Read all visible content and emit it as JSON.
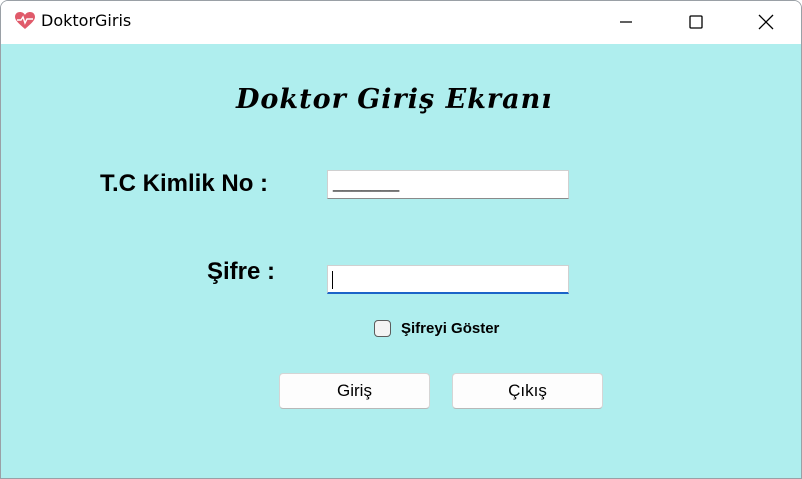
{
  "window": {
    "title": "DoktorGiris",
    "icon": "heart-icon"
  },
  "colors": {
    "client_background": "#afeeee",
    "focus_border": "#1b64c8"
  },
  "form": {
    "heading": "Doktor Giriş Ekranı",
    "tc_label": "T.C Kimlik No :",
    "tc_value": "_______",
    "password_label": "Şifre :",
    "password_value": "",
    "show_password_label": "Şifreyi Göster",
    "show_password_checked": false
  },
  "buttons": {
    "login": "Giriş",
    "exit": "Çıkış"
  }
}
